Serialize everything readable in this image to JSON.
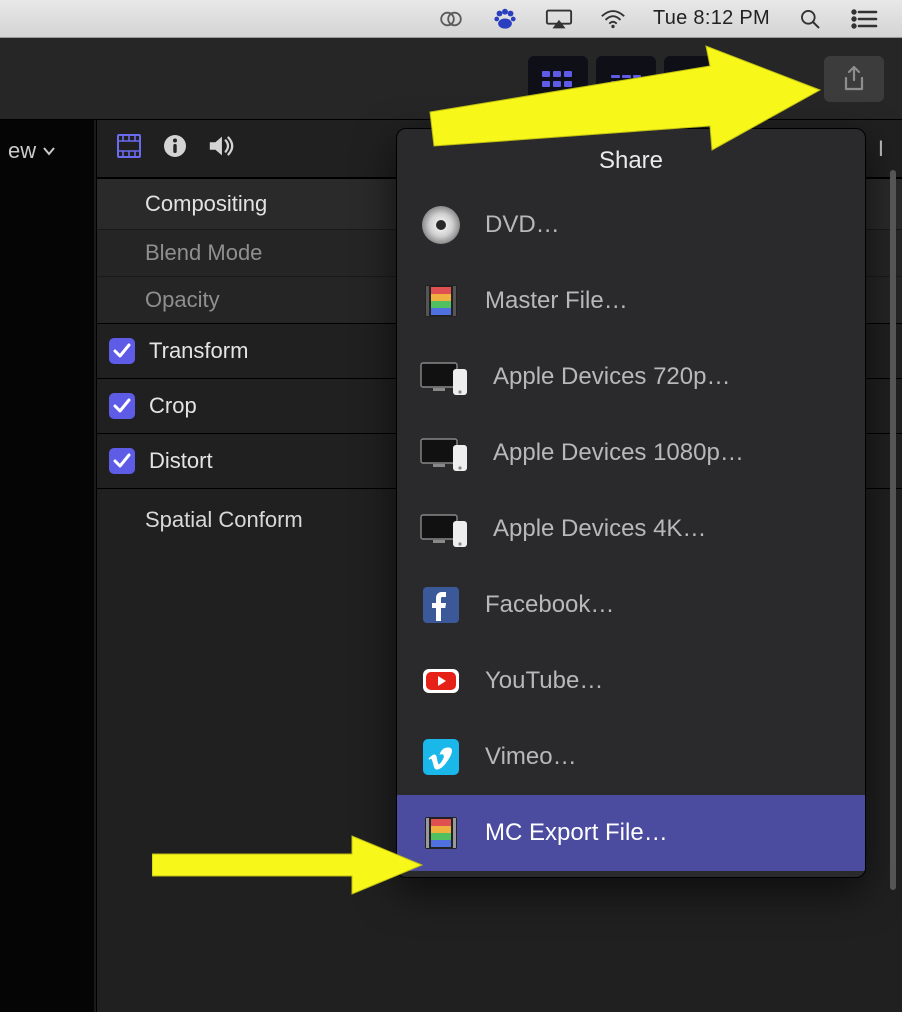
{
  "menubar": {
    "time": "Tue 8:12 PM"
  },
  "left": {
    "view_label": "ew"
  },
  "inspector": {
    "partial_label": "I",
    "compositing": "Compositing",
    "blend_mode": "Blend Mode",
    "opacity": "Opacity",
    "transform": "Transform",
    "crop": "Crop",
    "distort": "Distort",
    "spatial_conform": "Spatial Conform"
  },
  "share": {
    "title": "Share",
    "items": [
      {
        "label": "DVD…",
        "icon": "disc"
      },
      {
        "label": "Master File…",
        "icon": "film-color"
      },
      {
        "label": "Apple Devices 720p…",
        "icon": "devices"
      },
      {
        "label": "Apple Devices 1080p…",
        "icon": "devices"
      },
      {
        "label": "Apple Devices 4K…",
        "icon": "devices"
      },
      {
        "label": "Facebook…",
        "icon": "facebook"
      },
      {
        "label": "YouTube…",
        "icon": "youtube"
      },
      {
        "label": "Vimeo…",
        "icon": "vimeo"
      },
      {
        "label": "MC Export File…",
        "icon": "film-color",
        "selected": true
      }
    ]
  }
}
